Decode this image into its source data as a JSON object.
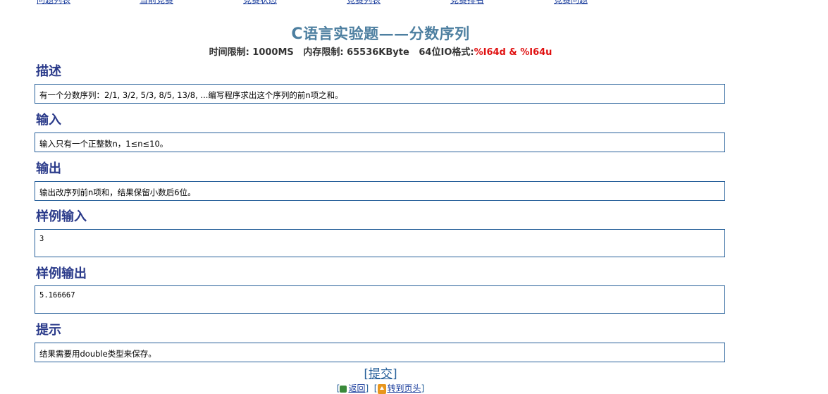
{
  "nav": {
    "items": [
      "问题列表",
      "当前竞赛",
      "竞赛状态",
      "竞赛列表",
      "竞赛排名",
      "竞赛问题"
    ]
  },
  "problem": {
    "title_prefix": "C",
    "title_rest": "语言实验题——分数序列",
    "limits": {
      "time": "时间限制: 1000MS",
      "memory": "内存限制: 65536KByte",
      "io_label": "64位IO格式:",
      "io_value": "%I64d & %I64u"
    }
  },
  "sections": {
    "description": {
      "heading": "描述",
      "text": "有一个分数序列：2/1, 3/2, 5/3, 8/5, 13/8, ...编写程序求出这个序列的前n项之和。"
    },
    "input": {
      "heading": "输入",
      "text": "输入只有一个正整数n，1≤n≤10。"
    },
    "output": {
      "heading": "输出",
      "text": "输出改序列前n项和，结果保留小数后6位。"
    },
    "sample_input": {
      "heading": "样例输入",
      "text": "3"
    },
    "sample_output": {
      "heading": "样例输出",
      "text": "5.166667"
    },
    "hint": {
      "heading": "提示",
      "text": "结果需要用double类型来保存。"
    }
  },
  "actions": {
    "submit_open": "[",
    "submit_label": "提交",
    "submit_close": "]",
    "back_label": "返回",
    "top_label": "转到页头"
  }
}
